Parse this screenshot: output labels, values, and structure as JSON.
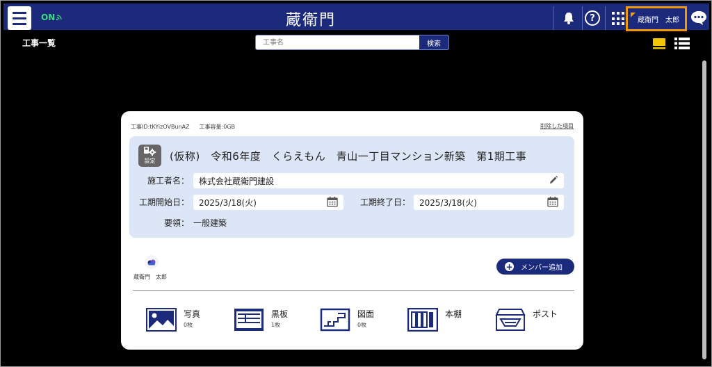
{
  "header": {
    "connection_status": "ON",
    "logo": "蔵衛門",
    "help_symbol": "?",
    "user_name": "蔵衛門　太郎",
    "colors": {
      "bar": "#1b2a7a",
      "user_highlight": "#f39800",
      "online": "#3ddc84"
    }
  },
  "subheader": {
    "page_title": "工事一覧",
    "search_placeholder": "工事名",
    "search_button": "検索"
  },
  "project": {
    "id_text": "工事ID:tKYizOVBunAZ",
    "capacity_text": "工事容量:0GB",
    "deleted_items_link": "削除した項目",
    "settings_label": "設定",
    "name": "(仮称)　令和6年度　くらえもん　青山一丁目マンション新築　第1期工事",
    "constructor_label": "施工者名：",
    "constructor_value": "株式会社蔵衛門建設",
    "start_label": "工期開始日：",
    "start_value": "2025/3/18(火)",
    "end_label": "工期終了日：",
    "end_value": "2025/3/18(火)",
    "outline_label": "要領：",
    "outline_value": "一般建築"
  },
  "members": {
    "list": [
      {
        "name": "蔵衛門　太郎"
      }
    ],
    "add_button": "メンバー追加"
  },
  "categories": [
    {
      "label": "写真",
      "count": "0枚",
      "icon": "photo-icon"
    },
    {
      "label": "黒板",
      "count": "1枚",
      "icon": "blackboard-icon"
    },
    {
      "label": "図面",
      "count": "0枚",
      "icon": "drawing-icon"
    },
    {
      "label": "本棚",
      "count": "",
      "icon": "bookshelf-icon"
    },
    {
      "label": "ポスト",
      "count": "",
      "icon": "mailbox-icon"
    }
  ]
}
